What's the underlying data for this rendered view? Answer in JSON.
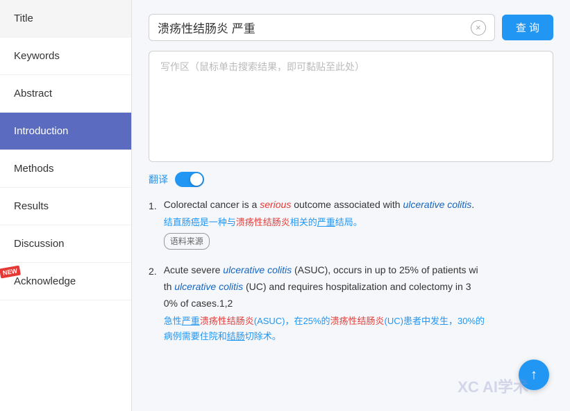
{
  "sidebar": {
    "items": [
      {
        "id": "title",
        "label": "Title",
        "active": false,
        "new": false
      },
      {
        "id": "keywords",
        "label": "Keywords",
        "active": false,
        "new": false
      },
      {
        "id": "abstract",
        "label": "Abstract",
        "active": false,
        "new": false
      },
      {
        "id": "introduction",
        "label": "Introduction",
        "active": true,
        "new": false
      },
      {
        "id": "methods",
        "label": "Methods",
        "active": false,
        "new": false
      },
      {
        "id": "results",
        "label": "Results",
        "active": false,
        "new": false
      },
      {
        "id": "discussion",
        "label": "Discussion",
        "active": false,
        "new": false
      },
      {
        "id": "acknowledge",
        "label": "Acknowledge",
        "active": false,
        "new": true
      }
    ]
  },
  "search": {
    "query": "溃疡性结肠炎 严重",
    "clear_label": "×",
    "query_button_label": "查 询"
  },
  "writing_area": {
    "placeholder": "写作区（鼠标单击搜索结果，即可黏贴至此处）"
  },
  "translate": {
    "label": "翻译",
    "enabled": true
  },
  "results": [
    {
      "number": "1.",
      "en_parts": [
        {
          "text": "Colorectal cancer is a ",
          "style": "normal"
        },
        {
          "text": "serious",
          "style": "italic-red"
        },
        {
          "text": " outcome associated with ",
          "style": "normal"
        },
        {
          "text": "ulcerative colitis",
          "style": "italic-blue"
        },
        {
          "text": ".",
          "style": "normal"
        }
      ],
      "cn_text": "结直肠癌是一种与溃疡性结肠炎相关的严重结局。",
      "source_tag": "语料来源"
    },
    {
      "number": "2.",
      "en_parts": [
        {
          "text": "Acute severe ",
          "style": "normal"
        },
        {
          "text": "ulcerative colitis",
          "style": "italic-blue"
        },
        {
          "text": " (ASUC), occurs in up to 25% of patients wi\nth ",
          "style": "normal"
        },
        {
          "text": "ulcerative colitis",
          "style": "italic-blue"
        },
        {
          "text": " (UC) and requires hospitalization and colectomy in 3\n0% of cases.1,2",
          "style": "normal"
        }
      ],
      "cn_text": "急性严重溃疡性结肠炎(ASUC)，在25%的溃疡性结肠炎(UC)患者中发生，30%的\n病例需要住院和结肠切除术。",
      "source_tag": null
    }
  ],
  "scroll_up": {
    "label": "↑"
  },
  "watermark": {
    "text": "XC AI学术"
  }
}
